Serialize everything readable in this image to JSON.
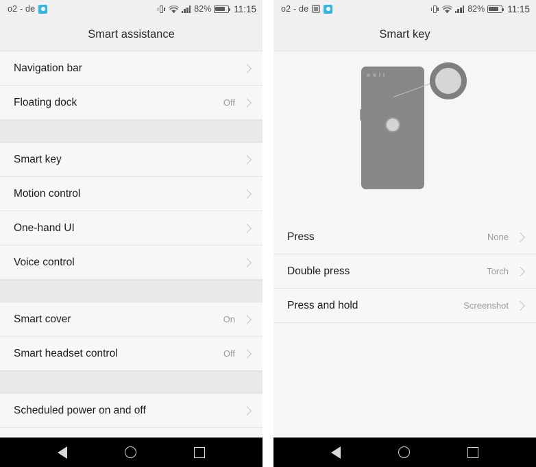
{
  "status_bar": {
    "carrier": "o2 - de",
    "battery_percent": "82%",
    "clock": "11:15",
    "icons_left_panel": [
      "camera-icon"
    ],
    "icons_right_panel": [
      "screenshot-icon",
      "camera-icon"
    ],
    "icons_right": [
      "vibrate-icon",
      "wifi-icon",
      "signal-icon",
      "battery-icon"
    ]
  },
  "left_screen": {
    "title": "Smart assistance",
    "groups": [
      {
        "rows": [
          {
            "label": "Navigation bar",
            "value": ""
          },
          {
            "label": "Floating dock",
            "value": "Off"
          }
        ]
      },
      {
        "rows": [
          {
            "label": "Smart key",
            "value": ""
          },
          {
            "label": "Motion control",
            "value": ""
          },
          {
            "label": "One-hand UI",
            "value": ""
          },
          {
            "label": "Voice control",
            "value": ""
          }
        ]
      },
      {
        "rows": [
          {
            "label": "Smart cover",
            "value": "On"
          },
          {
            "label": "Smart headset control",
            "value": "Off"
          }
        ]
      },
      {
        "rows": [
          {
            "label": "Scheduled power on and off",
            "value": ""
          }
        ]
      }
    ]
  },
  "right_screen": {
    "title": "Smart key",
    "illustration": {
      "name": "phone-back-with-fingerprint-sensor",
      "callout": "magnified-smart-key-button"
    },
    "rows": [
      {
        "label": "Press",
        "value": "None"
      },
      {
        "label": "Double press",
        "value": "Torch"
      },
      {
        "label": "Press and hold",
        "value": "Screenshot"
      }
    ]
  },
  "nav_bar": {
    "back": "back-icon",
    "home": "home-icon",
    "recents": "recents-icon"
  },
  "colors": {
    "accent": "#36b5e3",
    "row_bg": "#f7f7f7",
    "group_gap_bg": "#e9e9e9",
    "header_bg": "#f0f0f0",
    "illustration_gray": "#888888",
    "nav_bg": "#000000"
  }
}
